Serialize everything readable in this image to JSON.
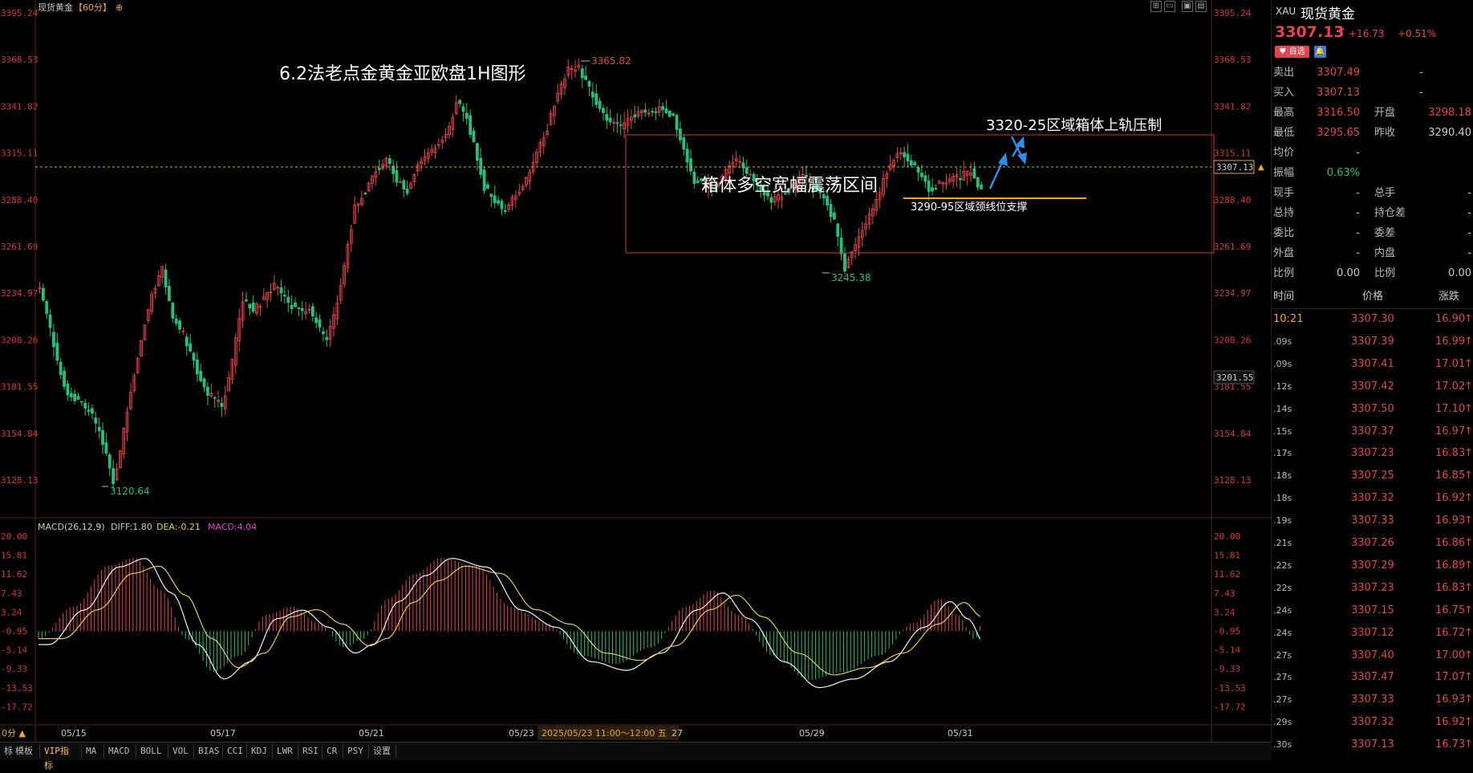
{
  "window": {
    "title": "现货黄金",
    "period": "【60分】",
    "settings_glyph": "⊕"
  },
  "annotations": {
    "main_title": "6.2法老点金黄金亚欧盘1H图形",
    "box_label": "箱体多空宽幅震荡区间",
    "upper_label": "3320-25区域箱体上轨压制",
    "support_label": "3290-95区域颈线位支撑",
    "high_marker": "3365.82",
    "low_marker_1": "3120.64",
    "low_marker_2": "3245.38"
  },
  "price_axis": {
    "ticks": [
      "3395.24",
      "3368.53",
      "3341.82",
      "3315.11",
      "3288.40",
      "3261.69",
      "3234.97",
      "3208.26",
      "3181.55",
      "3154.84",
      "3128.13"
    ],
    "current_price_tag": "3307.13",
    "hover_price_tag": "3201.55",
    "axis_up": "▲"
  },
  "macd": {
    "label": "MACD(26,12,9)",
    "diff": "DIFF:1.80",
    "dea": "DEA:-0.21",
    "macd": "MACD:4.04",
    "ticks": [
      "20.00",
      "15.81",
      "11.62",
      "7.43",
      "3.24",
      "-0.95",
      "-5.14",
      "-9.33",
      "-13.53",
      "-17.72"
    ]
  },
  "time_axis": {
    "dates": [
      "05/15",
      "05/17",
      "05/21",
      "05/23",
      "05/29",
      "05/31"
    ],
    "hover": "2025/05/23 11:00～12:00 五",
    "hover_tail": "27",
    "left_tag": "0分 ▲"
  },
  "tabs": [
    "标",
    "模板",
    "VIP指标",
    "MA",
    "MACD",
    "BOLL",
    "VOL",
    "BIAS",
    "CCI",
    "KDJ",
    "LWR",
    "RSI",
    "CR",
    "PSY",
    "设置"
  ],
  "quote": {
    "symbol": "XAU",
    "name": "现货黄金",
    "price": "3307.13",
    "arrow": "↑",
    "change": "+16.73",
    "change_pct": "+0.51%",
    "fav_label": "自选",
    "rows": [
      {
        "l1": "卖出",
        "v1": "3307.49",
        "l2": "-",
        "v2": ""
      },
      {
        "l1": "买入",
        "v1": "3307.13",
        "l2": "-",
        "v2": ""
      },
      {
        "l1": "最高",
        "v1": "3316.50",
        "l2": "开盘",
        "v2": "3298.18"
      },
      {
        "l1": "最低",
        "v1": "3295.65",
        "l2": "昨收",
        "v2": "3290.40"
      },
      {
        "l1": "均价",
        "v1": "-",
        "l2": "",
        "v2": ""
      },
      {
        "l1": "振幅",
        "v1": "0.63%",
        "l2": "",
        "v2": ""
      },
      {
        "l1": "现手",
        "v1": "-",
        "l2": "总手",
        "v2": "-"
      },
      {
        "l1": "总持",
        "v1": "-",
        "l2": "持仓差",
        "v2": "-"
      },
      {
        "l1": "委比",
        "v1": "-",
        "l2": "委差",
        "v2": "-"
      },
      {
        "l1": "外盘",
        "v1": "-",
        "l2": "内盘",
        "v2": "-"
      },
      {
        "l1": "比例",
        "v1": "0.00",
        "l2": "比例",
        "v2": "0.00"
      }
    ],
    "tick_header": {
      "time": "时间",
      "price": "价格",
      "chg": "涨跌"
    },
    "ticks": [
      {
        "t": "10:21",
        "p": "3307.30",
        "c": "16.90"
      },
      {
        "t": ".09s",
        "p": "3307.39",
        "c": "16.99"
      },
      {
        "t": ".09s",
        "p": "3307.41",
        "c": "17.01"
      },
      {
        "t": ".12s",
        "p": "3307.42",
        "c": "17.02"
      },
      {
        "t": ".14s",
        "p": "3307.50",
        "c": "17.10"
      },
      {
        "t": ".15s",
        "p": "3307.37",
        "c": "16.97"
      },
      {
        "t": ".17s",
        "p": "3307.23",
        "c": "16.83"
      },
      {
        "t": ".18s",
        "p": "3307.25",
        "c": "16.85"
      },
      {
        "t": ".18s",
        "p": "3307.32",
        "c": "16.92"
      },
      {
        "t": ".19s",
        "p": "3307.33",
        "c": "16.93"
      },
      {
        "t": ".21s",
        "p": "3307.26",
        "c": "16.86"
      },
      {
        "t": ".22s",
        "p": "3307.29",
        "c": "16.89"
      },
      {
        "t": ".22s",
        "p": "3307.23",
        "c": "16.83"
      },
      {
        "t": ".24s",
        "p": "3307.15",
        "c": "16.75"
      },
      {
        "t": ".24s",
        "p": "3307.12",
        "c": "16.72"
      },
      {
        "t": ".27s",
        "p": "3307.40",
        "c": "17.00"
      },
      {
        "t": ".27s",
        "p": "3307.47",
        "c": "17.07"
      },
      {
        "t": ".27s",
        "p": "3307.33",
        "c": "16.93"
      },
      {
        "t": ".29s",
        "p": "3307.32",
        "c": "16.92"
      },
      {
        "t": ".30s",
        "p": "3307.13",
        "c": "16.73"
      }
    ],
    "tick_arrow": "↑"
  },
  "colors": {
    "up": "#e8434a",
    "down": "#22c27a",
    "accent": "#f5a623",
    "macd_yellow": "#e6d32a",
    "macd_pink": "#e040c8",
    "box": "#d8333a"
  },
  "icons": [
    "gear-icon",
    "restore-icon",
    "fit-icon",
    "maximize-icon",
    "bell-icon",
    "heart-icon"
  ]
}
